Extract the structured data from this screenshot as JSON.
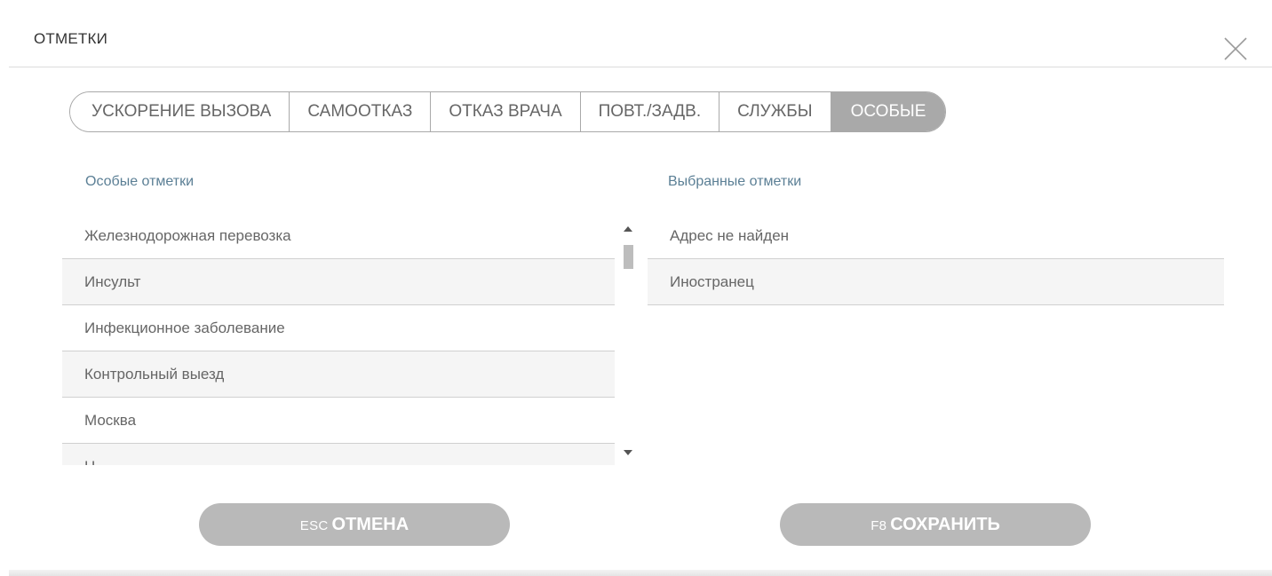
{
  "dialog": {
    "title": "ОТМЕТКИ",
    "close_icon": "close-icon"
  },
  "tabs": [
    {
      "label": "УСКОРЕНИЕ ВЫЗОВА",
      "active": false
    },
    {
      "label": "САМООТКАЗ",
      "active": false
    },
    {
      "label": "ОТКАЗ ВРАЧА",
      "active": false
    },
    {
      "label": "ПОВТ./ЗАДВ.",
      "active": false
    },
    {
      "label": "СЛУЖБЫ",
      "active": false
    },
    {
      "label": "ОСОБЫЕ",
      "active": true
    }
  ],
  "left_list": {
    "label": "Особые отметки",
    "items": [
      "Железнодорожная перевозка",
      "Инсульт",
      "Инфекционное заболевание",
      "Контрольный выезд",
      "Москва",
      "Н"
    ]
  },
  "right_list": {
    "label": "Выбранные отметки",
    "items": [
      "Адрес не найден",
      "Иностранец"
    ]
  },
  "buttons": {
    "cancel": {
      "key": "ESC",
      "label": "ОТМЕНА"
    },
    "save": {
      "key": "F8",
      "label": "СОХРАНИТЬ"
    }
  },
  "colors": {
    "active_tab": "#a9a9a9",
    "button": "#b9b9b9",
    "column_label": "#5b7f95"
  }
}
